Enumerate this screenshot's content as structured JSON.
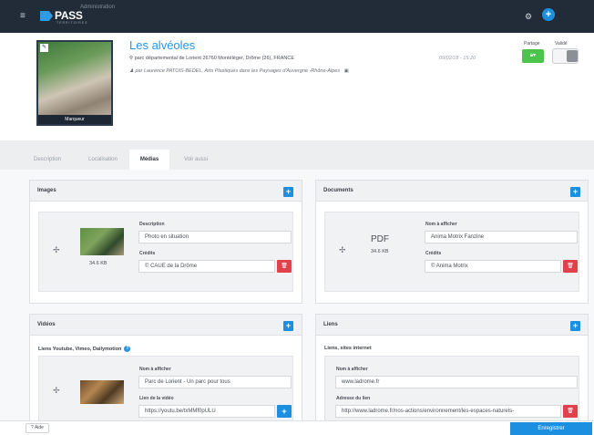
{
  "topbar": {
    "logo_name": "PASS",
    "logo_sub": "TERRITOIRES",
    "admin_label": "Administration",
    "gear_icon": "gear-icon",
    "plus_label": "+"
  },
  "header": {
    "thumbnail_caption": "Marqueur",
    "title": "Les alvéoles",
    "address_icon": "map-marker-icon",
    "address": "parc départemental de Lorient 26760 Montéléger, Drôme (26), FRANCE",
    "author_icon": "user-icon",
    "author": "par Laurence PATOIS-BEDEL, Arts Plastiques dans les Paysages d'Auvergne -Rhône-Alpes",
    "date": "09/02/18 - 15:20",
    "partage_label": "Partage",
    "valide_label": "Validé",
    "partage_icon": "lock-icon"
  },
  "tabs": [
    {
      "label": "Description",
      "active": false
    },
    {
      "label": "Localisation",
      "active": false
    },
    {
      "label": "Médias",
      "active": true
    },
    {
      "label": "Voir aussi",
      "active": false
    }
  ],
  "images": {
    "title": "Images",
    "size": "34.6 KB",
    "description_label": "Description",
    "description_value": "Photo en situation",
    "credits_label": "Crédits",
    "credits_value": "© CAUE de la Drôme"
  },
  "documents": {
    "title": "Documents",
    "file_type": "PDF",
    "size": "34.6 KB",
    "name_label": "Nom à afficher",
    "name_value": "Anima Motrix Fanzine",
    "credits_label": "Crédits",
    "credits_value": "© Anima Motrix"
  },
  "videos": {
    "title": "Vidéos",
    "subtitle": "Liens Youtube, Vimeo, Dailymotion",
    "name_label": "Nom à afficher",
    "name_value": "Parc de Lorient - Un parc pour tous",
    "link_label": "Lien de la vidéo",
    "link_value": "https://youtu.be/txMMf0pULU"
  },
  "liens": {
    "title": "Liens",
    "subtitle": "Liens, sites internet",
    "name_label": "Nom à afficher",
    "name_value": "www.ladrome.fr",
    "address_label": "Adresse du lien",
    "address_value": "http://www.ladrome.fr/nos-actions/environnement/les-espaces-naturels-"
  },
  "footer": {
    "help_label": "? Aide",
    "save_label": "Enregistrer"
  },
  "colors": {
    "accent": "#1d8fe0",
    "danger": "#e0414b",
    "success": "#4cc34a",
    "topbar": "#222c39"
  }
}
